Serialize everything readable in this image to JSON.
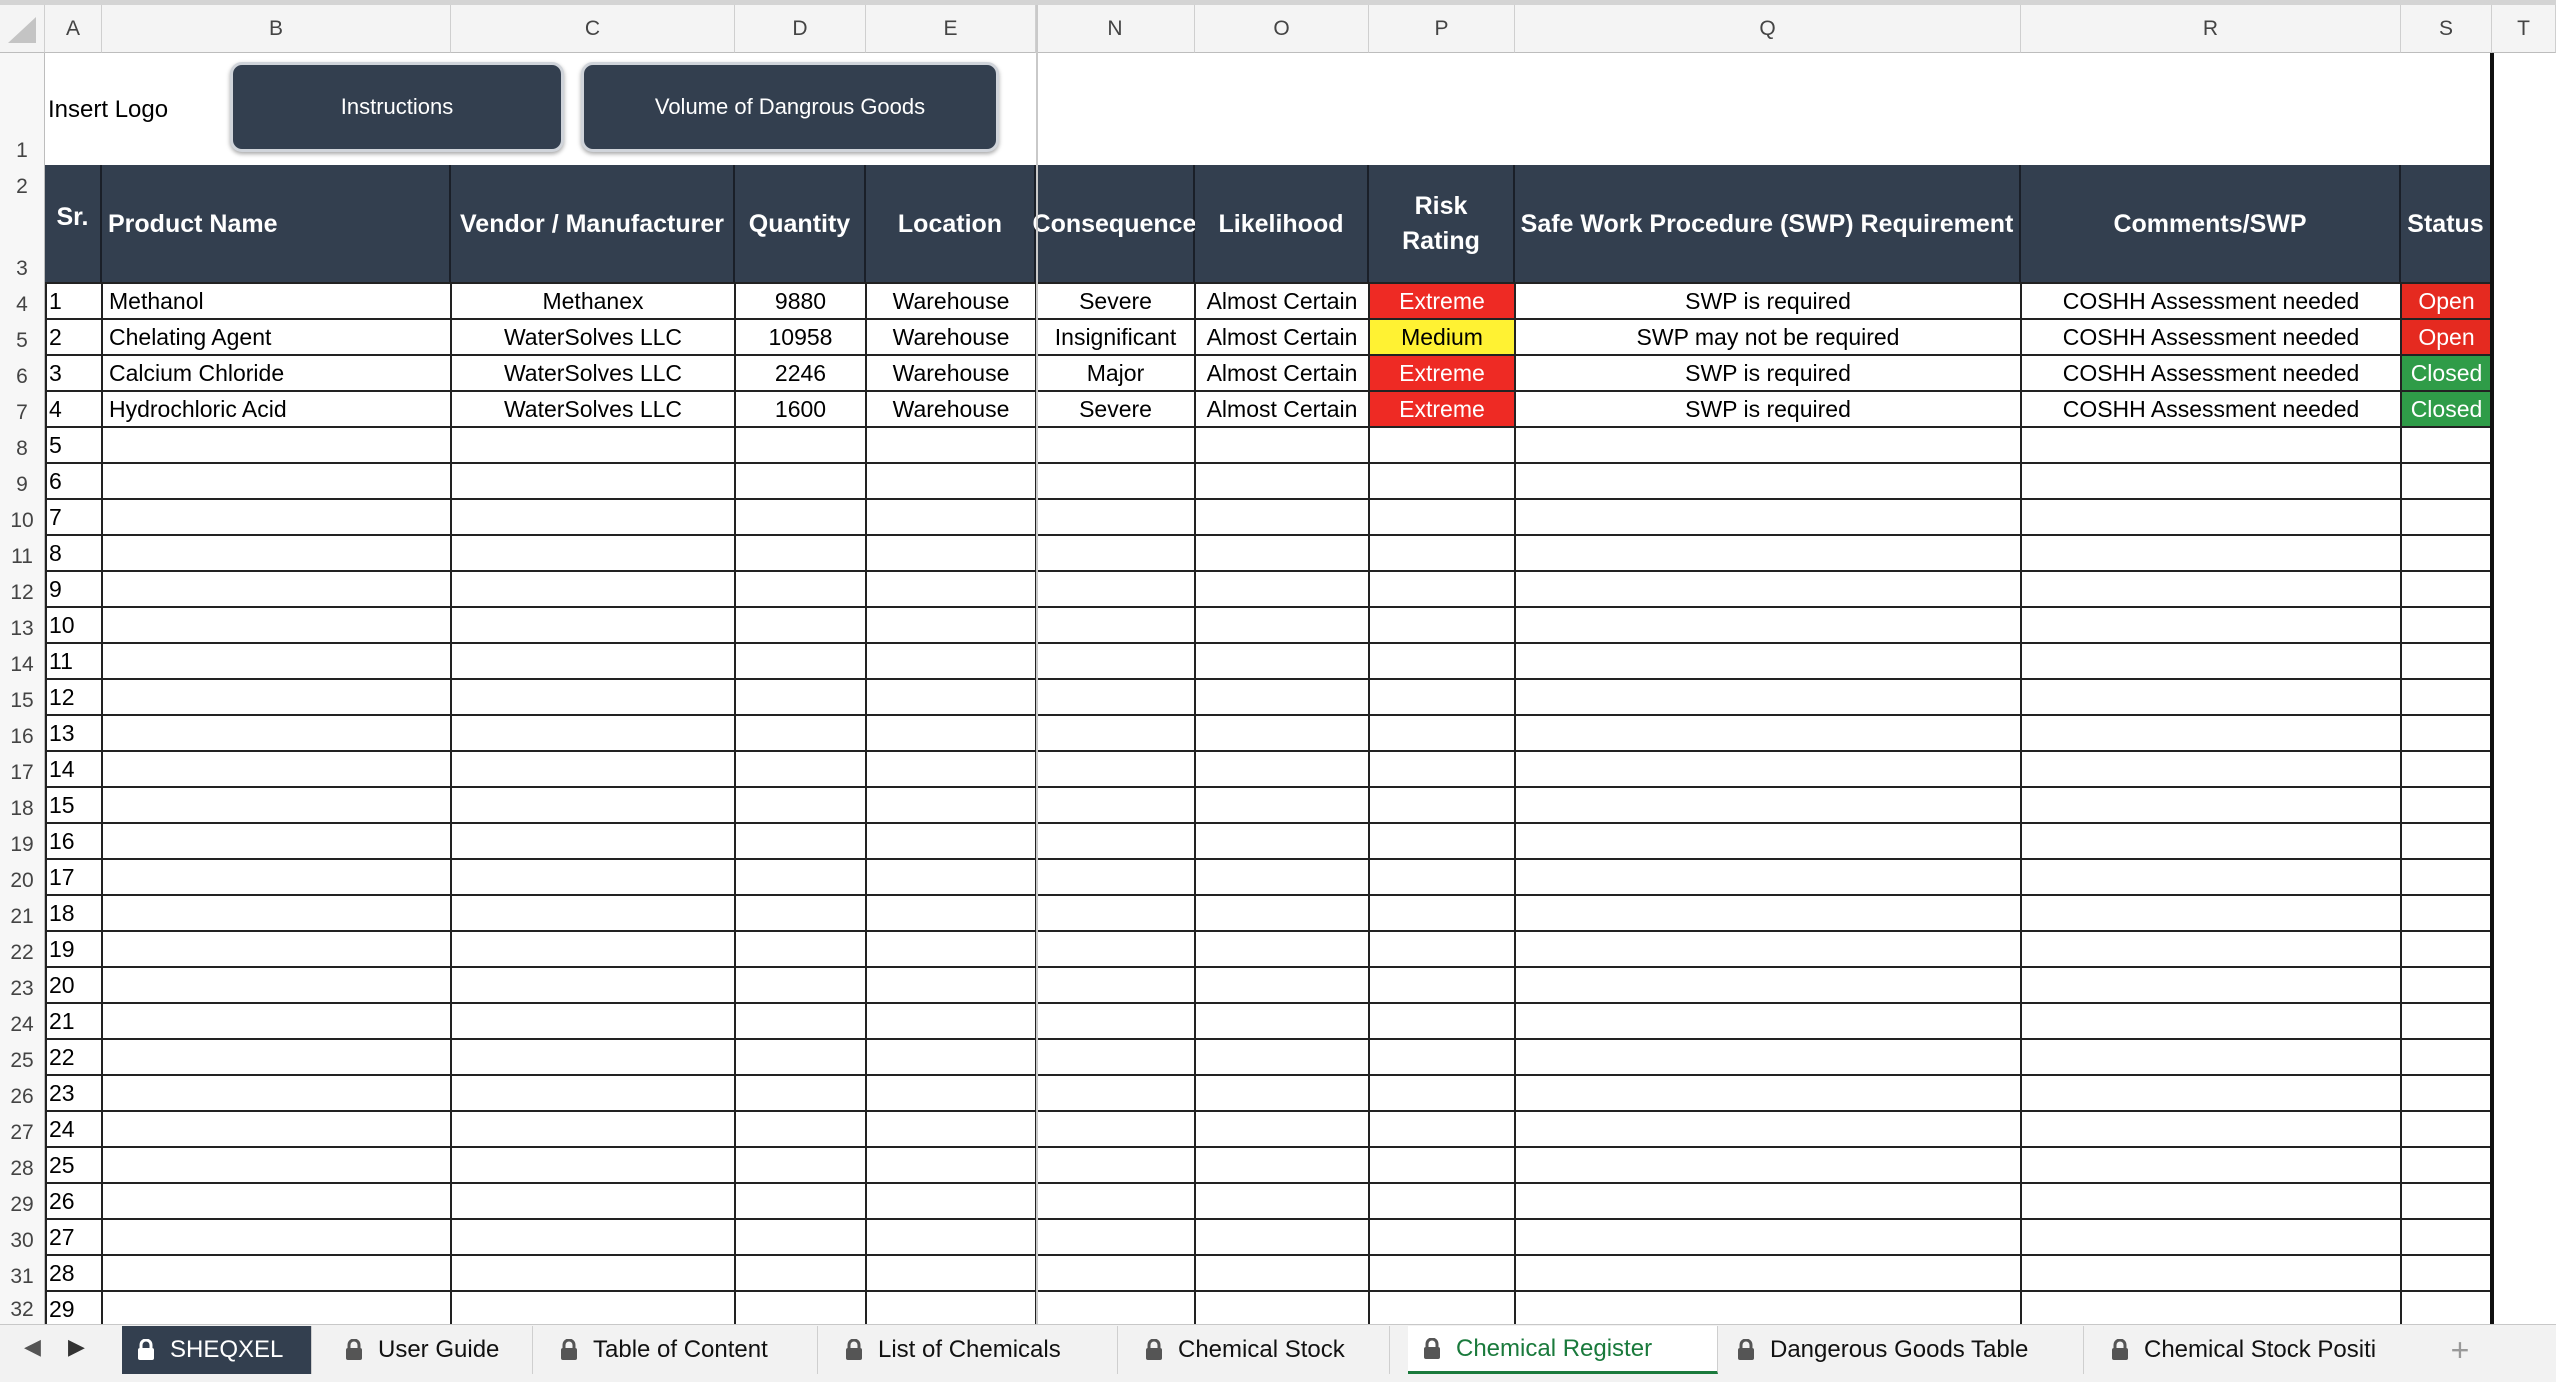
{
  "columns": [
    "A",
    "B",
    "C",
    "D",
    "E",
    "N",
    "O",
    "P",
    "Q",
    "R",
    "S",
    "T"
  ],
  "row_numbers": [
    "1",
    "2",
    "3",
    "4",
    "5",
    "6",
    "7",
    "8",
    "9",
    "10",
    "11",
    "12",
    "13",
    "14",
    "15",
    "16",
    "17",
    "18",
    "19",
    "20",
    "21",
    "22",
    "23",
    "24",
    "25",
    "26",
    "27",
    "28",
    "29",
    "30",
    "31",
    "32"
  ],
  "logo_text": "Insert Logo",
  "buttons": {
    "instructions": "Instructions",
    "volume": "Volume of Dangrous Goods"
  },
  "headers": {
    "sr": "Sr.",
    "product": "Product Name",
    "vendor": "Vendor / Manufacturer",
    "quantity": "Quantity",
    "location": "Location",
    "consequence": "Consequence",
    "likelihood": "Likelihood",
    "risk": "Risk Rating",
    "swp": "Safe Work Procedure (SWP) Requirement",
    "comments": "Comments/SWP",
    "status": "Status"
  },
  "rows": [
    {
      "sr": "1",
      "product": "Methanol",
      "vendor": "Methanex",
      "quantity": "9880",
      "location": "Warehouse",
      "consequence": "Severe",
      "likelihood": "Almost Certain",
      "risk": "Extreme",
      "swp": "SWP is required",
      "comments": "COSHH Assessment needed",
      "status": "Open"
    },
    {
      "sr": "2",
      "product": "Chelating Agent",
      "vendor": "WaterSolves LLC",
      "quantity": "10958",
      "location": "Warehouse",
      "consequence": "Insignificant",
      "likelihood": "Almost Certain",
      "risk": "Medium",
      "swp": "SWP may not be required",
      "comments": "COSHH Assessment needed",
      "status": "Open"
    },
    {
      "sr": "3",
      "product": "Calcium Chloride",
      "vendor": "WaterSolves LLC",
      "quantity": "2246",
      "location": "Warehouse",
      "consequence": "Major",
      "likelihood": "Almost Certain",
      "risk": "Extreme",
      "swp": "SWP is required",
      "comments": "COSHH Assessment needed",
      "status": "Closed"
    },
    {
      "sr": "4",
      "product": "Hydrochloric Acid",
      "vendor": "WaterSolves LLC",
      "quantity": "1600",
      "location": "Warehouse",
      "consequence": "Severe",
      "likelihood": "Almost Certain",
      "risk": "Extreme",
      "swp": "SWP is required",
      "comments": "COSHH Assessment needed",
      "status": "Closed"
    }
  ],
  "empty_sr": [
    "5",
    "6",
    "7",
    "8",
    "9",
    "10",
    "11",
    "12",
    "13",
    "14",
    "15",
    "16",
    "17",
    "18",
    "19",
    "20",
    "21",
    "22",
    "23",
    "24",
    "25",
    "26",
    "27",
    "28",
    "29"
  ],
  "risk_colors": {
    "Extreme": "#ee2a24",
    "Medium": "#fff233"
  },
  "status_colors": {
    "Open": "#e52a20",
    "Closed": "#2f9c48"
  },
  "tabs": [
    {
      "label": "SHEQXEL",
      "style": "dark"
    },
    {
      "label": "User Guide",
      "style": "normal"
    },
    {
      "label": "Table of Content",
      "style": "normal"
    },
    {
      "label": "List of Chemicals",
      "style": "normal"
    },
    {
      "label": "Chemical Stock",
      "style": "normal"
    },
    {
      "label": "Chemical Register",
      "style": "active"
    },
    {
      "label": "Dangerous Goods Table",
      "style": "normal"
    },
    {
      "label": "Chemical Stock Positi",
      "style": "normal"
    }
  ],
  "add_sheet": "+"
}
